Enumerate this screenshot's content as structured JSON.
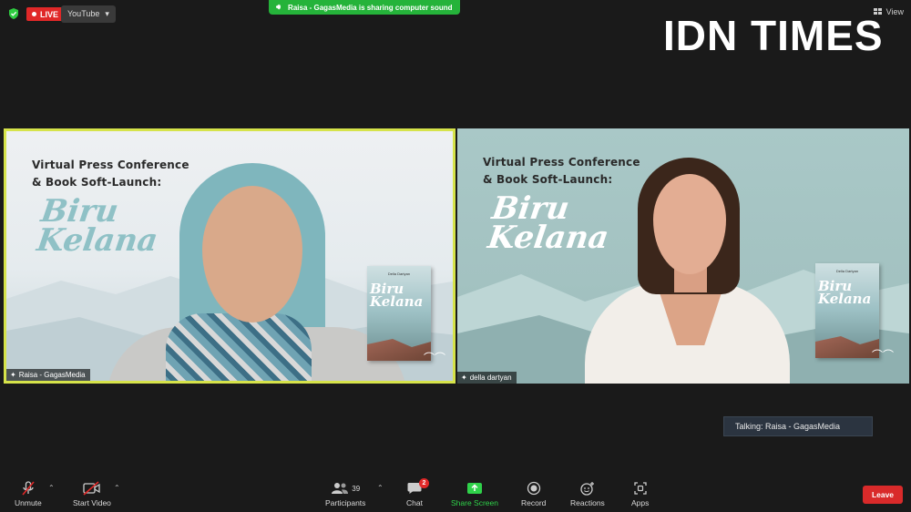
{
  "top_bar": {
    "live_label": "LIVE",
    "stream_target": "YouTube",
    "share_notice": "Raisa - GagasMedia is sharing computer sound",
    "view_label": "View",
    "brand": "IDN TIMES"
  },
  "tiles": [
    {
      "name": "Raisa - GagasMedia",
      "title_line1": "Virtual Press Conference",
      "title_line2": "& Book Soft-Launch:",
      "script_line1": "Biru",
      "script_line2": "Kelana",
      "book_author": "Della Dartyan",
      "book_title1": "Biru",
      "book_title2": "Kelana",
      "active_speaker": true
    },
    {
      "name": "della dartyan",
      "title_line1": "Virtual Press Conference",
      "title_line2": "& Book Soft-Launch:",
      "script_line1": "Biru",
      "script_line2": "Kelana",
      "book_author": "Della Dartyan",
      "book_title1": "Biru",
      "book_title2": "Kelana",
      "active_speaker": false
    }
  ],
  "talking_indicator": "Talking: Raisa - GagasMedia",
  "toolbar": {
    "unmute": "Unmute",
    "start_video": "Start Video",
    "participants": "Participants",
    "participants_count": "39",
    "chat": "Chat",
    "chat_badge": "2",
    "share_screen": "Share Screen",
    "record": "Record",
    "reactions": "Reactions",
    "apps": "Apps",
    "leave": "Leave"
  },
  "colors": {
    "live_red": "#e02828",
    "share_green": "#25b33a",
    "active_border": "#d6e34a",
    "leave_red": "#d92a2a"
  }
}
